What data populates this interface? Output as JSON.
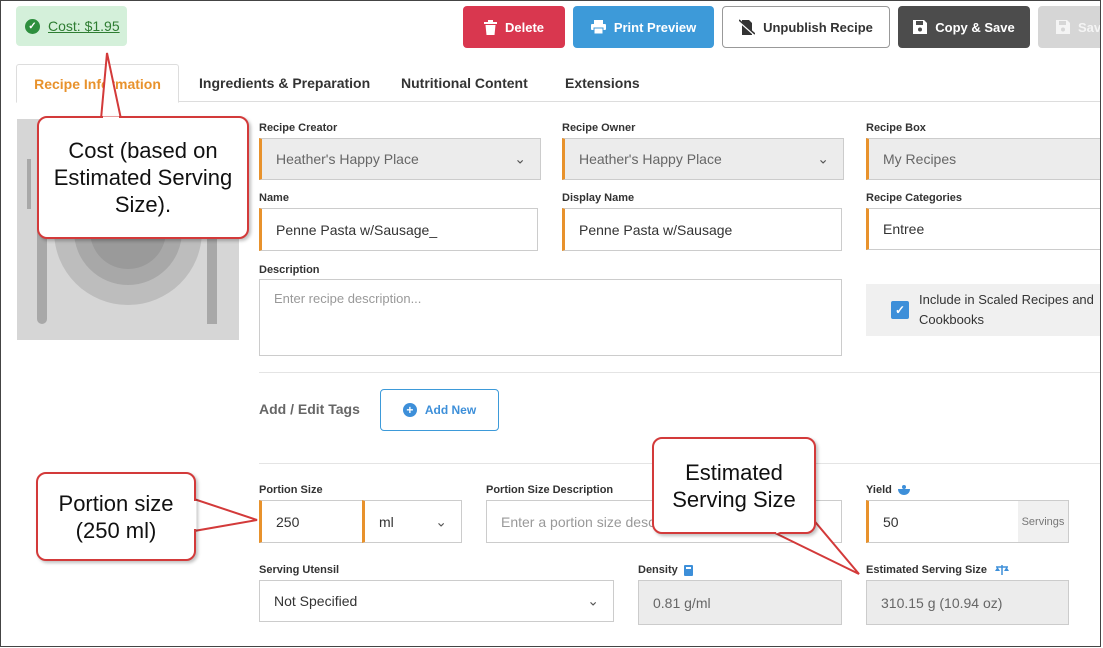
{
  "cost": {
    "label": "Cost: $1.95"
  },
  "toolbar": {
    "delete_label": "Delete",
    "print_label": "Print Preview",
    "unpublish_label": "Unpublish Recipe",
    "copy_label": "Copy & Save",
    "save_label": "Save"
  },
  "tabs": [
    {
      "label": "Recipe Information",
      "active": true
    },
    {
      "label": "Ingredients & Preparation"
    },
    {
      "label": "Nutritional Content"
    },
    {
      "label": "Extensions"
    }
  ],
  "form": {
    "creator": {
      "label": "Recipe Creator",
      "value": "Heather's Happy Place"
    },
    "owner": {
      "label": "Recipe Owner",
      "value": "Heather's Happy Place"
    },
    "box": {
      "label": "Recipe Box",
      "value": "My Recipes"
    },
    "name": {
      "label": "Name",
      "value": "Penne Pasta w/Sausage_"
    },
    "display_name": {
      "label": "Display Name",
      "value": "Penne Pasta w/Sausage"
    },
    "categories": {
      "label": "Recipe Categories",
      "value": "Entree"
    },
    "description": {
      "label": "Description",
      "placeholder": "Enter recipe description..."
    },
    "include_scaled": {
      "label": "Include in Scaled Recipes and Cookbooks",
      "checked": true
    },
    "tags": {
      "label": "Add / Edit Tags",
      "add_label": "Add New"
    },
    "portion_size": {
      "label": "Portion Size",
      "value": "250",
      "unit": "ml"
    },
    "portion_desc": {
      "label": "Portion Size Description",
      "placeholder": "Enter a portion size description"
    },
    "yield": {
      "label": "Yield",
      "value": "50",
      "suffix": "Servings"
    },
    "utensil": {
      "label": "Serving Utensil",
      "value": "Not Specified"
    },
    "density": {
      "label": "Density",
      "value": "0.81 g/ml"
    },
    "est_serving": {
      "label": "Estimated Serving Size",
      "value": "310.15 g (10.94 oz)"
    }
  },
  "callouts": {
    "cost": "Cost (based on Estimated Serving Size).",
    "portion": "Portion size (250 ml)",
    "estimated": "Estimated Serving Size"
  },
  "colors": {
    "accent": "#e8922c",
    "primary": "#3d9ad9",
    "danger": "#d9374f",
    "callout_border": "#d33a3a"
  }
}
